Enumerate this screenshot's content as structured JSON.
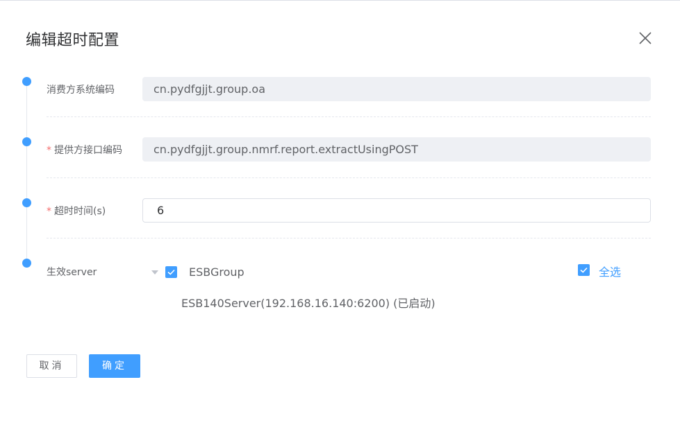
{
  "dialog": {
    "title": "编辑超时配置",
    "close_icon": "close-icon"
  },
  "form": {
    "consumer_label": "消费方系统编码",
    "consumer_value": "cn.pydfgjjt.group.oa",
    "provider_label": "提供方接口编码",
    "provider_value": "cn.pydfgjjt.group.nmrf.report.extractUsingPOST",
    "timeout_label": "超时时间(s)",
    "timeout_value": "6",
    "server_label": "生效server",
    "required_mark": "*"
  },
  "tree": {
    "group_label": "ESBGroup",
    "group_checked": true,
    "child_label": "ESB140Server(192.168.16.140:6200) (已启动)",
    "select_all_label": "全选",
    "select_all_checked": true
  },
  "buttons": {
    "cancel_label": "取消",
    "confirm_label": "确定"
  },
  "colors": {
    "accent": "#409eff",
    "required": "#f56c6c",
    "disabled_bg": "#eef0f4"
  }
}
